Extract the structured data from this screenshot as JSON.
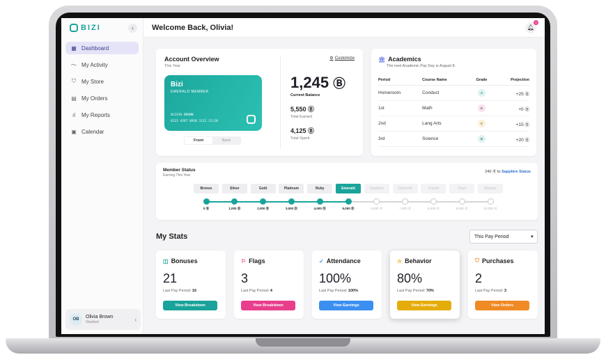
{
  "brand": {
    "name": "BIZI"
  },
  "sidebar": {
    "items": [
      {
        "label": "Dashboard",
        "icon": "▦",
        "active": true
      },
      {
        "label": "My Activity",
        "icon": "〜"
      },
      {
        "label": "My Store",
        "icon": "⛉"
      },
      {
        "label": "My Orders",
        "icon": "▤"
      },
      {
        "label": "My Reports",
        "icon": "ıl"
      },
      {
        "label": "Calendar",
        "icon": "▣"
      }
    ],
    "user": {
      "initials": "OB",
      "name": "Olivia Brown",
      "role": "Student"
    }
  },
  "header": {
    "welcome": "Welcome Back, Olivia!",
    "notifications": "1"
  },
  "account": {
    "title": "Account Overview",
    "subtitle": "This Year",
    "customize": "Customize",
    "card": {
      "brand": "Bizi",
      "tier": "EMERALD MEMBER",
      "holder": "OLIVIA BROWN",
      "number": "0123 4567 8910 1112   12/28"
    },
    "toggle": {
      "front": "Front",
      "back": "Back"
    },
    "balance": "1,245",
    "balance_label": "Current Balance",
    "earned": "5,550",
    "earned_label": "Total Earned",
    "spent": "4,125",
    "spent_label": "Total Spent",
    "coin_symbol": "Ⓑ"
  },
  "academics": {
    "title": "Academics",
    "subtitle": "The next Academic Pay Day is August 8.",
    "columns": [
      "Period",
      "Course Name",
      "Grade",
      "Projection"
    ],
    "rows": [
      {
        "period": "Homeroom",
        "course": "Conduct",
        "grade": "A",
        "projection": "+25",
        "color": "#d9f4f1"
      },
      {
        "period": "1st",
        "course": "Math",
        "grade": "D",
        "projection": "+0",
        "color": "#fbe2ee"
      },
      {
        "period": "2nd",
        "course": "Lang Arts",
        "grade": "C",
        "projection": "+15",
        "color": "#fdf0d6"
      },
      {
        "period": "3rd",
        "course": "Science",
        "grade": "B",
        "projection": "+20",
        "color": "#d9f4f1"
      }
    ]
  },
  "member_status": {
    "title": "Member Status",
    "subtitle": "Earning This Year",
    "next_amount": "240",
    "next_to": "to",
    "next_tier": "Sapphire Status",
    "tiers": [
      {
        "name": "Bronze",
        "amount": "0",
        "state": "done"
      },
      {
        "name": "Silver",
        "amount": "1,000",
        "state": "done"
      },
      {
        "name": "Gold",
        "amount": "2,000",
        "state": "done"
      },
      {
        "name": "Platinum",
        "amount": "3,000",
        "state": "done"
      },
      {
        "name": "Ruby",
        "amount": "4,000",
        "state": "done"
      },
      {
        "name": "Emerald",
        "amount": "5,000",
        "state": "current"
      },
      {
        "name": "Sapphire",
        "amount": "6,000",
        "state": "future"
      },
      {
        "name": "Diamond",
        "amount": "7,000",
        "state": "future"
      },
      {
        "name": "Crystal",
        "amount": "8,000",
        "state": "future"
      },
      {
        "name": "Onyx",
        "amount": "9,000",
        "state": "future"
      },
      {
        "name": "Mystery",
        "amount": "10,000",
        "state": "future"
      }
    ]
  },
  "stats": {
    "title": "My Stats",
    "period": "This Pay Period",
    "last_label": "Last Pay Period:",
    "cards": [
      {
        "title": "Bonuses",
        "icon": "◫",
        "icon_color": "#1aa39a",
        "value": "21",
        "last": "16",
        "button": "View Breakdown",
        "color": "#1aa39a"
      },
      {
        "title": "Flags",
        "icon": "⚐",
        "icon_color": "#e83e8c",
        "value": "3",
        "last": "4",
        "button": "View Breakdown",
        "color": "#e83e8c"
      },
      {
        "title": "Attendance",
        "icon": "✓",
        "icon_color": "#3b8ff0",
        "value": "100%",
        "last": "100%",
        "button": "View Earnings",
        "color": "#3b8ff0"
      },
      {
        "title": "Behavior",
        "icon": "☆",
        "icon_color": "#e5ad0b",
        "value": "80%",
        "last": "70%",
        "button": "View Earnings",
        "color": "#e5ad0b"
      },
      {
        "title": "Purchases",
        "icon": "⛉",
        "icon_color": "#f08a24",
        "value": "2",
        "last": "3",
        "button": "View Orders",
        "color": "#f08a24"
      }
    ]
  }
}
